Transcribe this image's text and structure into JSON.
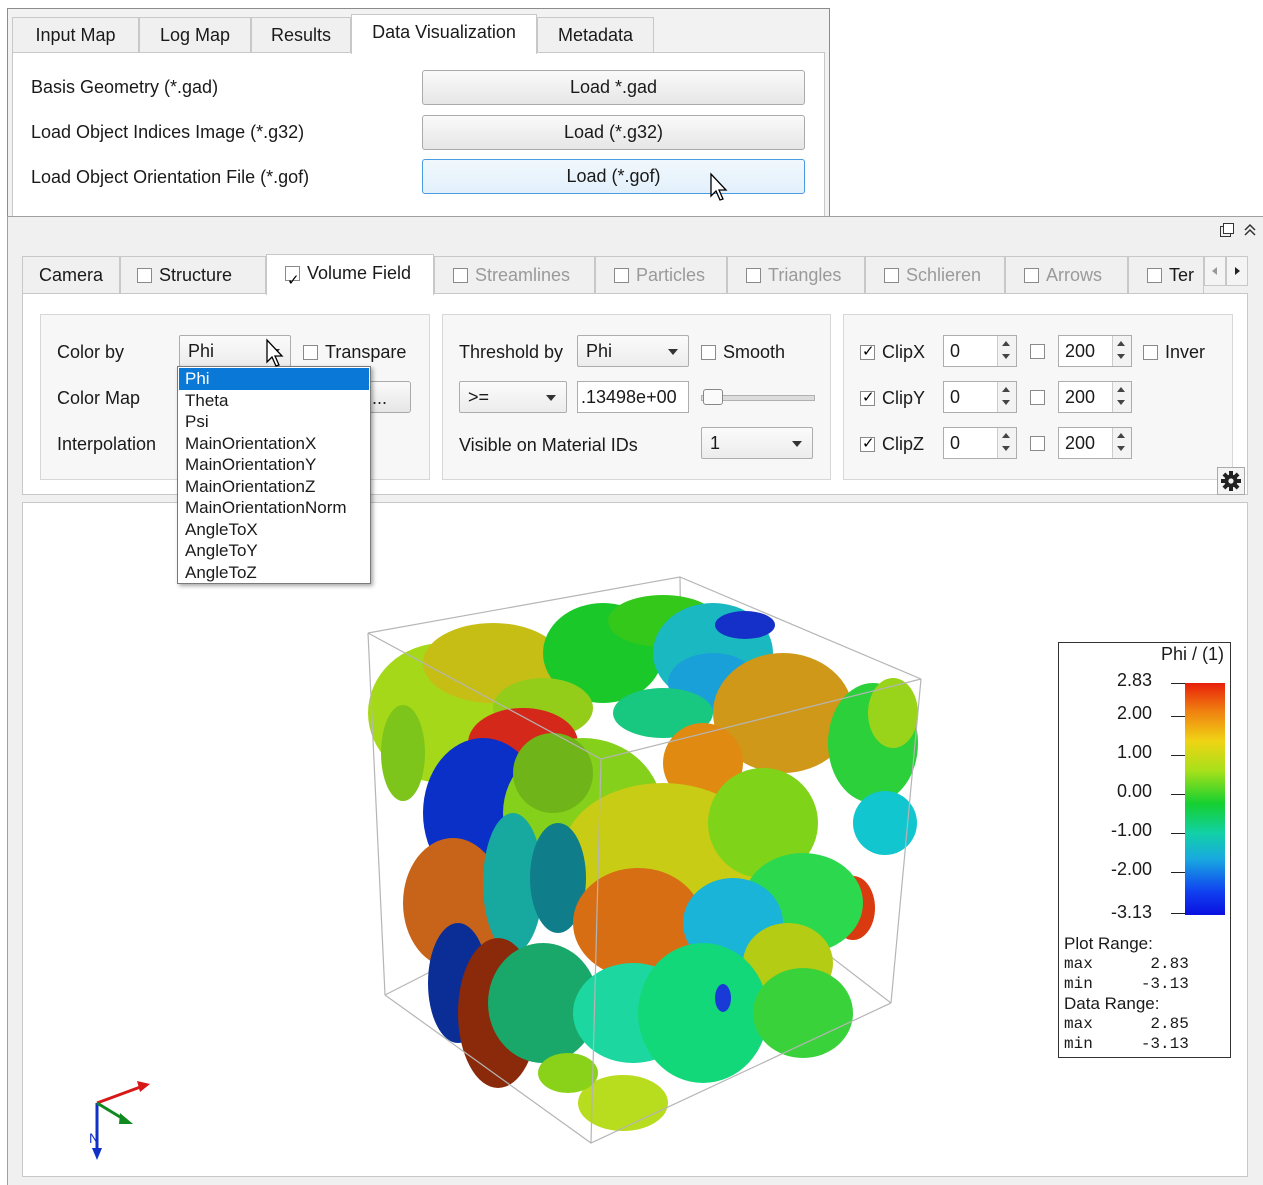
{
  "top_tabs": [
    "Input Map",
    "Log Map",
    "Results",
    "Data Visualization",
    "Metadata"
  ],
  "load_rows": [
    {
      "label": "Basis Geometry (*.gad)",
      "button": "Load *.gad"
    },
    {
      "label": "Load Object Indices Image (*.g32)",
      "button": "Load (*.g32)"
    },
    {
      "label": "Load Object Orientation File (*.gof)",
      "button": "Load (*.gof)"
    }
  ],
  "dock_tabs": [
    {
      "label": "Camera"
    },
    {
      "label": "Structure"
    },
    {
      "label": "Volume Field"
    },
    {
      "label": "Streamlines"
    },
    {
      "label": "Particles"
    },
    {
      "label": "Triangles"
    },
    {
      "label": "Schlieren"
    },
    {
      "label": "Arrows"
    },
    {
      "label": "Ter"
    }
  ],
  "color_group": {
    "color_by_label": "Color by",
    "color_by_value": "Phi",
    "transparent_label": "Transpare",
    "color_map_label": "Color Map",
    "interpolation_label": "Interpolation",
    "color_map_button": "..."
  },
  "threshold_group": {
    "threshold_by_label": "Threshold by",
    "threshold_by_value": "Phi",
    "smooth_label": "Smooth",
    "operator_value": ">=",
    "threshold_value": ".13498e+00",
    "visible_label": "Visible on Material IDs",
    "visible_value": "1"
  },
  "clip_group": {
    "clips": [
      {
        "label": "ClipX",
        "min": "0",
        "max": "200"
      },
      {
        "label": "ClipY",
        "min": "0",
        "max": "200"
      },
      {
        "label": "ClipZ",
        "min": "0",
        "max": "200"
      }
    ],
    "invert_label": "Inver"
  },
  "dropdown_options": [
    "Phi",
    "Theta",
    "Psi",
    "MainOrientationX",
    "MainOrientationY",
    "MainOrientationZ",
    "MainOrientationNorm",
    "AngleToX",
    "AngleToY",
    "AngleToZ"
  ],
  "legend": {
    "title": "Phi / (1)",
    "ticks": [
      "2.83",
      "2.00",
      "1.00",
      "0.00",
      "-1.00",
      "-2.00",
      "-3.13"
    ],
    "plot_range_label": "Plot Range:",
    "plot_max": "max      2.83",
    "plot_min": "min     -3.13",
    "data_range_label": "Data Range:",
    "data_max": "max      2.85",
    "data_min": "min     -3.13"
  }
}
